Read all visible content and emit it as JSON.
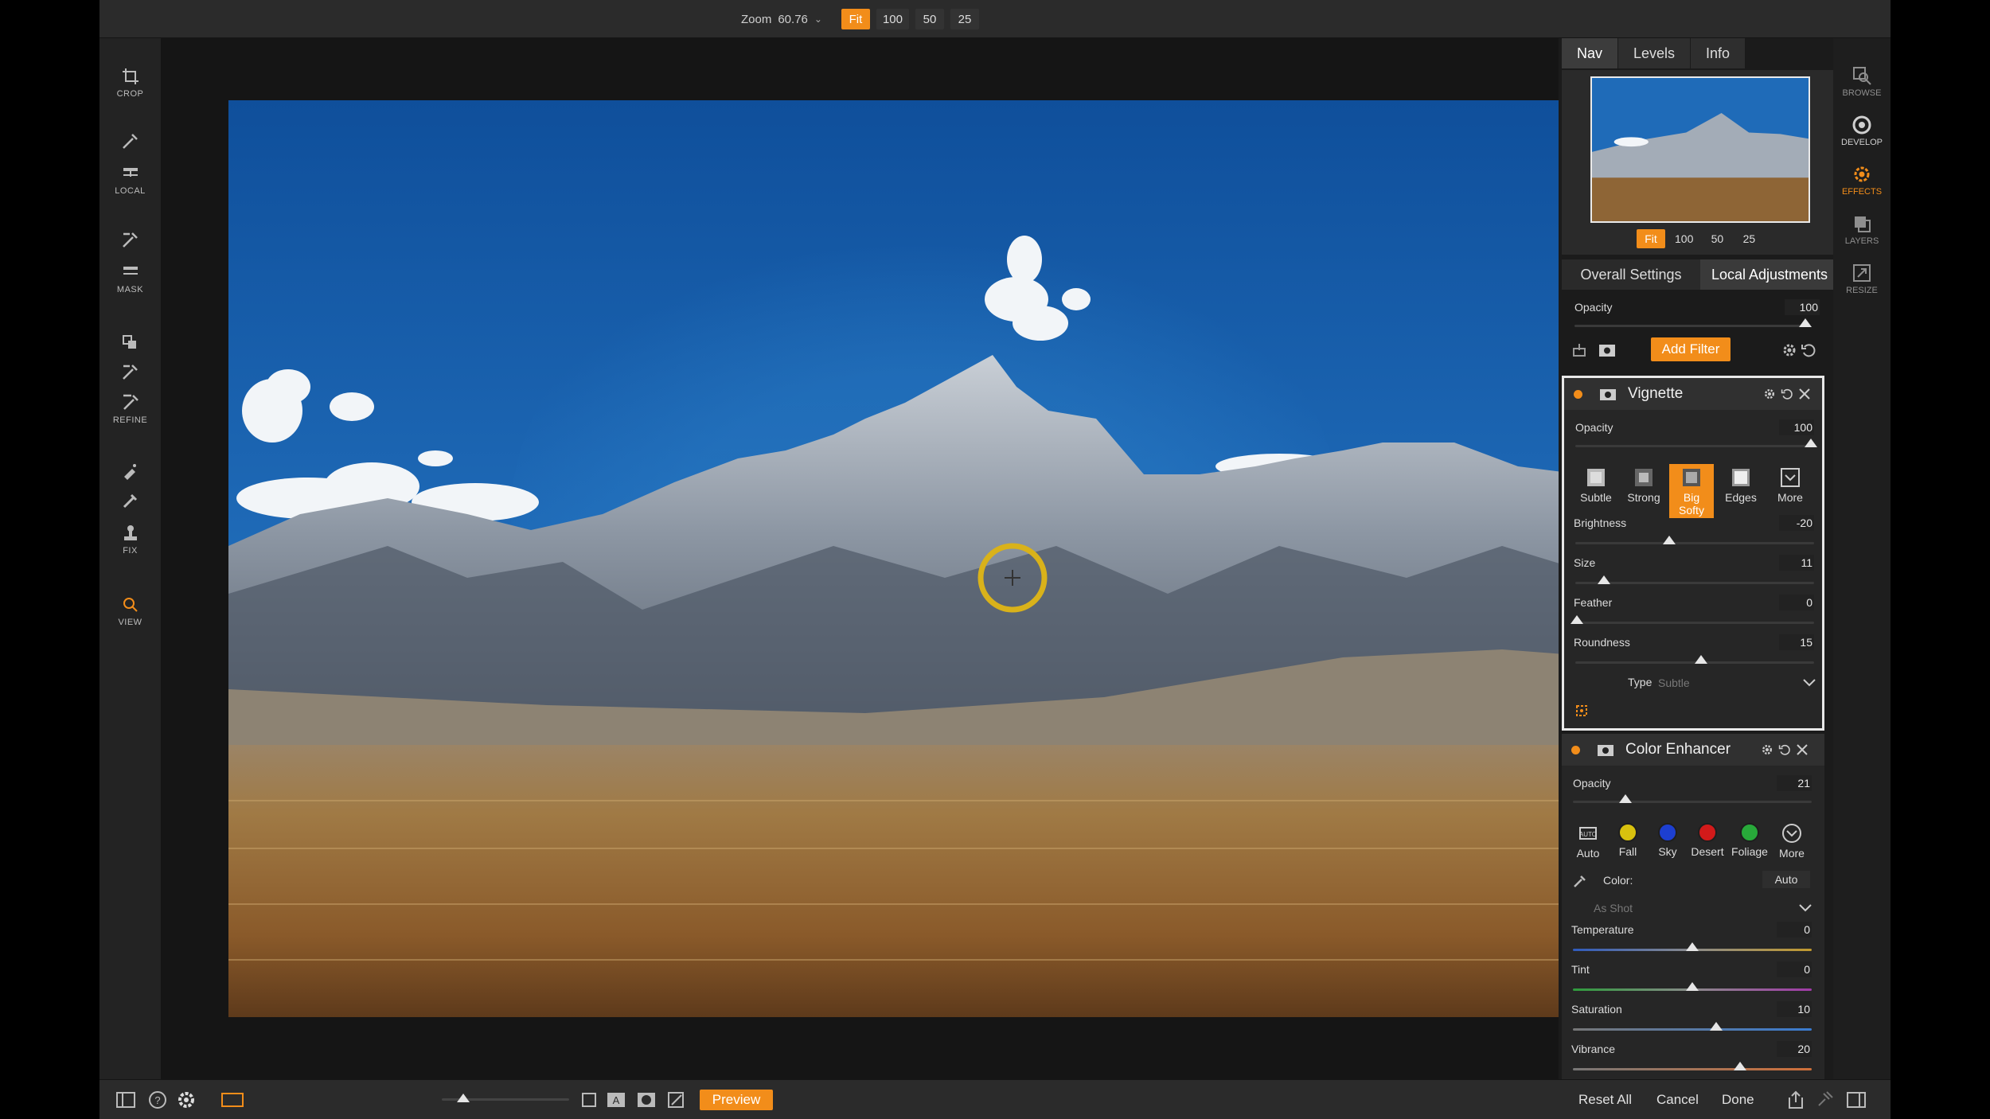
{
  "topbar": {
    "zoom_label": "Zoom",
    "zoom_value": "60.76",
    "zoom_buttons": [
      "Fit",
      "100",
      "50",
      "25"
    ],
    "zoom_active": "Fit"
  },
  "left_tools": {
    "crop": "CROP",
    "local": "LOCAL",
    "mask": "MASK",
    "refine": "REFINE",
    "fix": "FIX",
    "view": "VIEW"
  },
  "modules": {
    "browse": "BROWSE",
    "develop": "DEVELOP",
    "effects": "EFFECTS",
    "layers": "LAYERS",
    "resize": "RESIZE",
    "active": "EFFECTS"
  },
  "panel": {
    "tabs": [
      "Nav",
      "Levels",
      "Info"
    ],
    "nav_zoom": [
      "Fit",
      "100",
      "50",
      "25"
    ],
    "section_tabs": [
      "Overall Settings",
      "Local Adjustments"
    ],
    "overall": {
      "opacity_label": "Opacity",
      "opacity_value": "100",
      "add_filter": "Add Filter"
    },
    "vignette": {
      "title": "Vignette",
      "opacity_label": "Opacity",
      "opacity_value": "100",
      "presets": [
        "Subtle",
        "Strong",
        "Big Softy",
        "Edges",
        "More"
      ],
      "active_preset": "Big Softy",
      "brightness_label": "Brightness",
      "brightness_value": "-20",
      "size_label": "Size",
      "size_value": "11",
      "feather_label": "Feather",
      "feather_value": "0",
      "roundness_label": "Roundness",
      "roundness_value": "15",
      "type_label": "Type",
      "type_value": "Subtle"
    },
    "color_enhancer": {
      "title": "Color Enhancer",
      "opacity_label": "Opacity",
      "opacity_value": "21",
      "presets": [
        "Auto",
        "Fall",
        "Sky",
        "Desert",
        "Foliage",
        "More"
      ],
      "color_label": "Color:",
      "color_auto": "Auto",
      "as_shot": "As Shot",
      "temperature_label": "Temperature",
      "temperature_value": "0",
      "tint_label": "Tint",
      "tint_value": "0",
      "saturation_label": "Saturation",
      "saturation_value": "10",
      "vibrance_label": "Vibrance",
      "vibrance_value": "20"
    }
  },
  "bottombar": {
    "preview": "Preview",
    "reset_all": "Reset All",
    "cancel": "Cancel",
    "done": "Done"
  },
  "colors": {
    "accent": "#f28d1a",
    "sky": "#1e5fa8",
    "fall": "#d8c10e",
    "sky_dot": "#1d3fd0",
    "desert": "#d21a1a",
    "foliage": "#28a93a"
  }
}
